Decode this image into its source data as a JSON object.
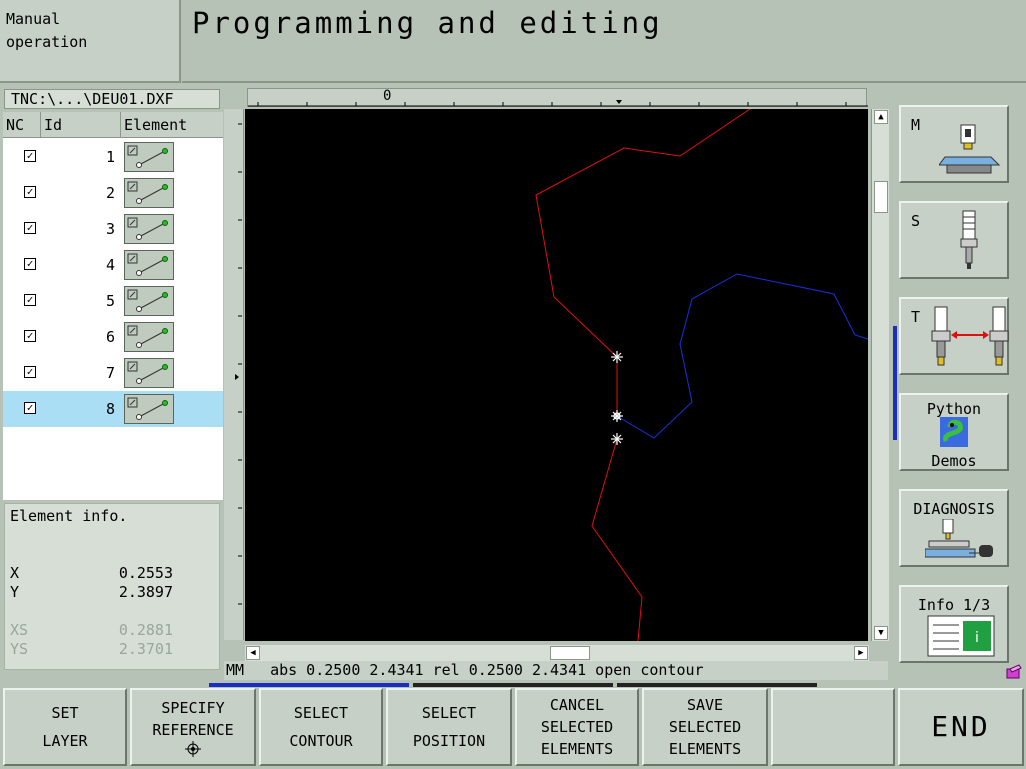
{
  "header": {
    "mode": "Manual\noperation",
    "title": "Programming and editing"
  },
  "file": {
    "name": "TNC:\\...\\DEU01.DXF"
  },
  "table": {
    "columns": [
      "NC",
      "Id",
      "Element"
    ],
    "rows": [
      {
        "checked": true,
        "id": "1"
      },
      {
        "checked": true,
        "id": "2"
      },
      {
        "checked": true,
        "id": "3"
      },
      {
        "checked": true,
        "id": "4"
      },
      {
        "checked": true,
        "id": "5"
      },
      {
        "checked": true,
        "id": "6"
      },
      {
        "checked": true,
        "id": "7"
      },
      {
        "checked": true,
        "id": "8",
        "selected": true
      }
    ]
  },
  "element_info": {
    "title": "Element info.",
    "x_label": "X",
    "x_value": "0.2553",
    "y_label": "Y",
    "y_value": "2.3897",
    "xs_label": "XS",
    "xs_value": "0.2881",
    "ys_label": "YS",
    "ys_value": "2.3701"
  },
  "ruler": {
    "zero_label": "0"
  },
  "status": {
    "unit": "MM",
    "text": "abs 0.2500 2.4341 rel 0.2500 2.4341 open contour"
  },
  "side_buttons": {
    "m": "M",
    "s": "S",
    "t": "T",
    "python_line1": "Python",
    "python_line2": "Demos",
    "diagnosis": "DIAGNOSIS",
    "info": "Info 1/3"
  },
  "softkeys": {
    "set_layer_1": "SET",
    "set_layer_2": "LAYER",
    "specify_1": "SPECIFY",
    "specify_2": "REFERENCE",
    "select_contour_1": "SELECT",
    "select_contour_2": "CONTOUR",
    "select_position_1": "SELECT",
    "select_position_2": "POSITION",
    "cancel_1": "CANCEL",
    "cancel_2": "SELECTED",
    "cancel_3": "ELEMENTS",
    "save_1": "SAVE",
    "save_2": "SELECTED",
    "save_3": "ELEMENTS",
    "end": "END"
  },
  "colors": {
    "background": "#b6c2b6",
    "canvas": "#000000",
    "contour_red": "#e01010",
    "contour_blue": "#1a2fe0",
    "selection": "#a9def5"
  }
}
